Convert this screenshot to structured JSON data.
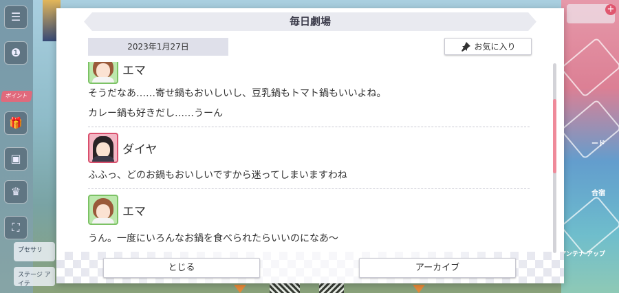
{
  "background": {
    "left_tag": "ポイント",
    "left_bar_1": "プセサリ",
    "left_bar_2": "ステージ アイテ",
    "right_label_1": "合宿",
    "right_label_2": "ード",
    "right_label_3": "アンテナ アップ"
  },
  "dialog": {
    "title": "毎日劇場",
    "date": "2023年1月27日",
    "favorite_label": "お気に入り",
    "entries": [
      {
        "speaker": "エマ",
        "lines": [
          "そうだなあ……寄せ鍋もおいしいし、豆乳鍋もトマト鍋もいいよね。",
          "カレー鍋も好きだし……うーん"
        ]
      },
      {
        "speaker": "ダイヤ",
        "lines": [
          "ふふっ、どのお鍋もおいしいですから迷ってしまいますわね"
        ]
      },
      {
        "speaker": "エマ",
        "lines": [
          "うん。一度にいろんなお鍋を食べられたらいいのになあ～"
        ]
      }
    ],
    "close_label": "とじる",
    "archive_label": "アーカイブ"
  },
  "colors": {
    "accent_scroll": "#ef8a9a",
    "ema_frame": "#7cc265",
    "dia_frame": "#d94f6c"
  }
}
